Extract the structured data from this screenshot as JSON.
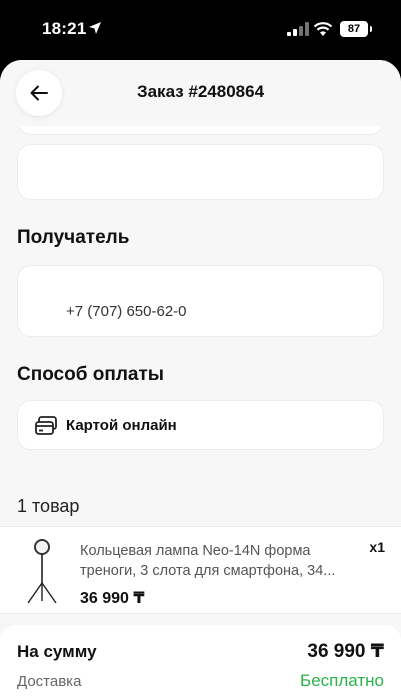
{
  "status_bar": {
    "time": "18:21",
    "battery": "87"
  },
  "header": {
    "title": "Заказ #2480864"
  },
  "recipient": {
    "section_title": "Получатель",
    "phone": "+7 (707) 650-62-0"
  },
  "payment": {
    "section_title": "Способ оплаты",
    "method": "Картой онлайн"
  },
  "items": {
    "count_label": "1 товар",
    "list": [
      {
        "name": "Кольцевая лампа Neo-14N форма треноги, 3 слота для смартфона, 34...",
        "quantity": "x1",
        "price": "36 990 ₸"
      }
    ]
  },
  "summary": {
    "total_label": "На сумму",
    "total_value": "36 990 ₸",
    "delivery_label": "Доставка",
    "delivery_value": "Бесплатно"
  },
  "colors": {
    "accent_green": "#2bb34b",
    "background": "#f7f7f8"
  }
}
